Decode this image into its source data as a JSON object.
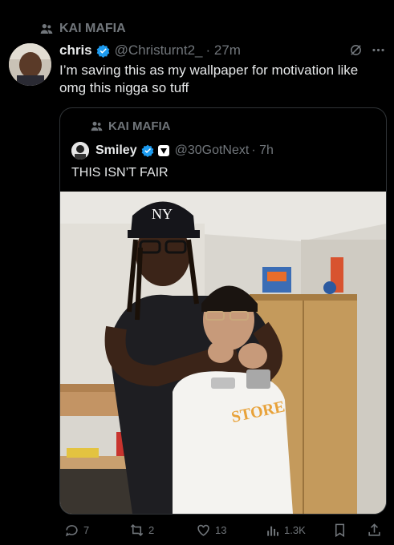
{
  "community": {
    "label": "KAI MAFIA",
    "icon": "people-icon"
  },
  "tweet": {
    "author_name": "chris",
    "handle": "@Christurnt2_",
    "time": "· 27m",
    "text": "I’m saving this as my wallpaper for motivation like omg this nigga so tuff",
    "verified_color": "#1d9bf0"
  },
  "quote": {
    "community_label": "KAI MAFIA",
    "author_name": "Smiley",
    "handle": "@30GotNext",
    "time": "· 7h",
    "text": "THIS ISN’T FAIR"
  },
  "photo": {
    "cap_text": "NY",
    "jersey_text": "STORE"
  },
  "actions": {
    "replies": "7",
    "reposts": "2",
    "likes": "13",
    "views": "1.3K"
  }
}
